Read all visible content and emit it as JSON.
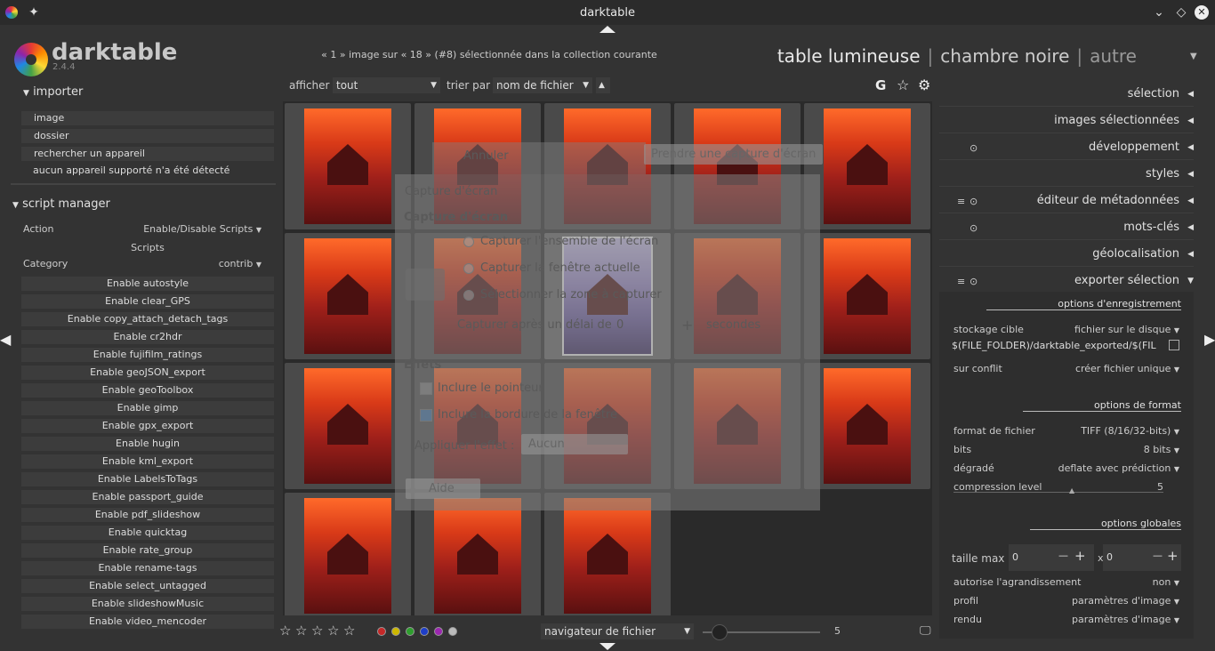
{
  "window": {
    "title": "darktable"
  },
  "header": {
    "app_name": "darktable",
    "version": "2.4.4",
    "collection_info": "« 1 » image sur « 18 » (#8) sélectionnée dans la collection courante",
    "views": {
      "lighttable": "table lumineuse",
      "darkroom": "chambre noire",
      "other": "autre"
    }
  },
  "left": {
    "import": {
      "title": "importer",
      "buttons": [
        "image",
        "dossier",
        "rechercher un appareil",
        "aucun appareil supporté n'a été détecté"
      ]
    },
    "script_manager": {
      "title": "script manager",
      "action_label": "Action",
      "action_value": "Enable/Disable Scripts",
      "scripts_label": "Scripts",
      "category_label": "Category",
      "category_value": "contrib",
      "scripts": [
        "Enable autostyle",
        "Enable clear_GPS",
        "Enable copy_attach_detach_tags",
        "Enable cr2hdr",
        "Enable fujifilm_ratings",
        "Enable geoJSON_export",
        "Enable geoToolbox",
        "Enable gimp",
        "Enable gpx_export",
        "Enable hugin",
        "Enable kml_export",
        "Enable LabelsToTags",
        "Enable passport_guide",
        "Enable pdf_slideshow",
        "Enable quicktag",
        "Enable rate_group",
        "Enable rename-tags",
        "Enable select_untagged",
        "Enable slideshowMusic",
        "Enable video_mencoder"
      ]
    }
  },
  "toolbar": {
    "show_label": "afficher",
    "show_value": "tout",
    "sort_label": "trier par",
    "sort_value": "nom de fichier",
    "sort_dir_icon": "▲",
    "icons": [
      "G",
      "☆",
      "⚙"
    ]
  },
  "screenshot_dialog": {
    "cancel": "Annuler",
    "take": "Prendre une capture d'écran",
    "title": "Capture d'écran",
    "section": "Capture d'écran",
    "opt_entire": "Capturer l'ensemble de l'écran",
    "opt_window": "Capturer la fenêtre actuelle",
    "opt_area": "Sélectionner la zone à capturer",
    "delay_label": "Capturer après un délai de",
    "delay_value": "0",
    "delay_unit": "secondes",
    "effects_title": "Effets",
    "include_pointer": "Inclure le pointeur",
    "include_border": "Inclure la bordure de la fenêtre",
    "apply_effect_label": "Appliquer l'effet :",
    "apply_effect_value": "Aucun",
    "help": "Aide"
  },
  "bottom": {
    "stars": [
      "☆",
      "☆",
      "☆",
      "☆",
      "☆"
    ],
    "color_labels": [
      "#c62828",
      "#cdb800",
      "#2e9e2e",
      "#1e3ec8",
      "#9c27b0",
      "#bbbbbb"
    ],
    "navigator": "navigateur de fichier",
    "zoom": "5"
  },
  "right": {
    "modules": [
      "sélection",
      "images sélectionnées",
      "développement",
      "styles",
      "éditeur de métadonnées",
      "mots-clés",
      "géolocalisation",
      "exporter sélection"
    ],
    "export": {
      "storage_header": "options d'enregistrement",
      "target_label": "stockage cible",
      "target_value": "fichier sur le disque",
      "path": "$(FILE_FOLDER)/darktable_exported/$(FIL",
      "conflict_label": "sur conflit",
      "conflict_value": "créer fichier unique",
      "format_header": "options de format",
      "format_label": "format de fichier",
      "format_value": "TIFF (8/16/32-bits)",
      "bits_label": "bits",
      "bits_value": "8 bits",
      "compress_label": "dégradé",
      "compress_value": "deflate avec prédiction",
      "level_label": "compression level",
      "level_value": "5",
      "global_header": "options globales",
      "maxsize_label": "taille max",
      "w": "0",
      "h": "0",
      "x": "x",
      "upscale_label": "autorise l'agrandissement",
      "upscale_value": "non",
      "profile_label": "profil",
      "profile_value": "paramètres d'image",
      "intent_label": "rendu",
      "intent_value": "paramètres d'image"
    }
  }
}
